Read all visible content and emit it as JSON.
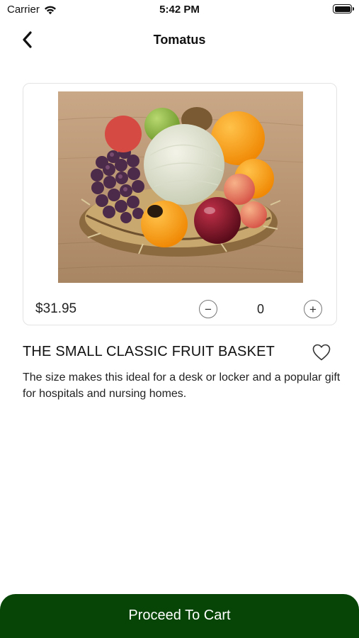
{
  "status_bar": {
    "carrier": "Carrier",
    "time": "5:42 PM",
    "icons": [
      "wifi-icon",
      "battery-icon"
    ]
  },
  "nav": {
    "back_icon": "chevron-left-icon",
    "title": "Tomatus"
  },
  "product": {
    "image": "fruit-basket-photo",
    "price": "$31.95",
    "quantity": "0",
    "decrement_label": "−",
    "increment_label": "+",
    "name": "THE SMALL CLASSIC FRUIT BASKET",
    "favorite_icon": "heart-outline-icon",
    "description": "The size makes this ideal for a desk or locker and a popular gift for hospitals and nursing homes."
  },
  "footer": {
    "proceed_label": "Proceed To Cart"
  },
  "colors": {
    "primary": "#064506",
    "card_border": "#e3e3e3",
    "text": "#111111"
  }
}
